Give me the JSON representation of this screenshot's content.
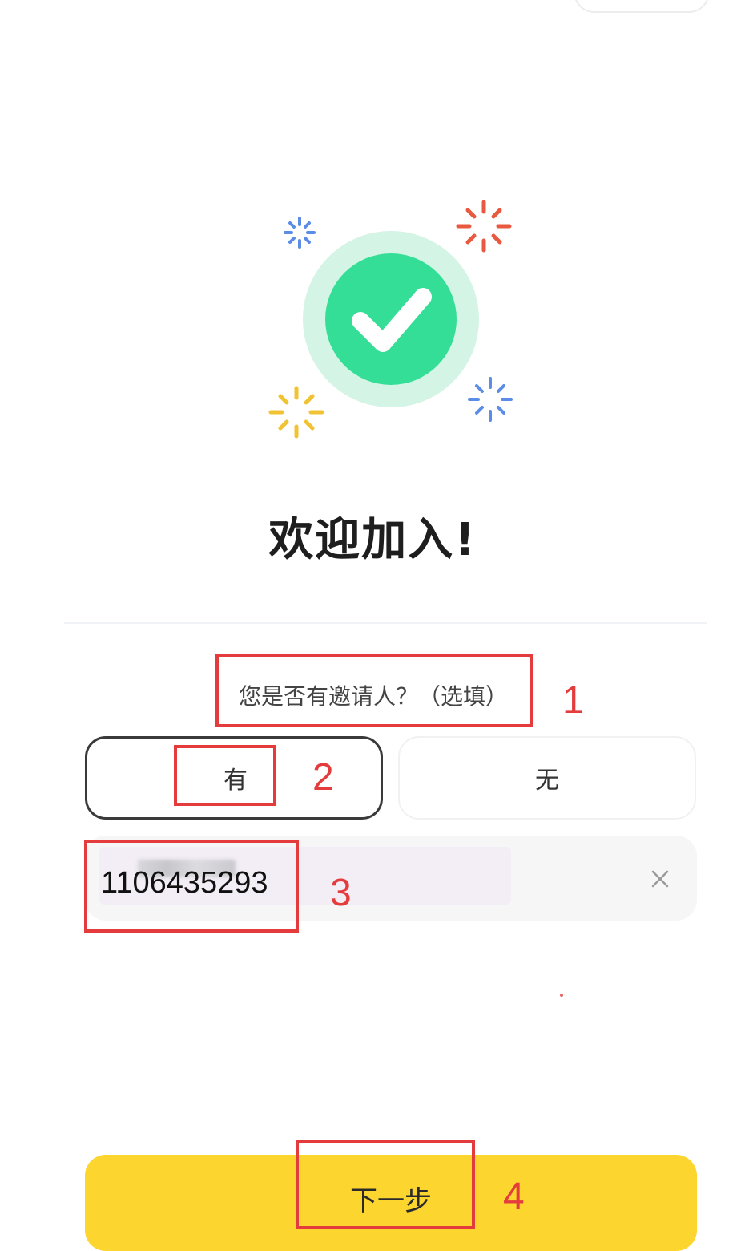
{
  "welcome": {
    "title": "欢迎加入!"
  },
  "inviter": {
    "question": "您是否有邀请人？（选填）",
    "option_yes": "有",
    "option_no": "无",
    "value": "1106435293",
    "clear_icon": "close-icon"
  },
  "actions": {
    "next_label": "下一步"
  },
  "annotations": [
    "1",
    "2",
    "3",
    "4"
  ],
  "colors": {
    "accent_yellow": "#fdd52f",
    "success_green": "#35de96",
    "annotation_red": "#e43c3c"
  }
}
